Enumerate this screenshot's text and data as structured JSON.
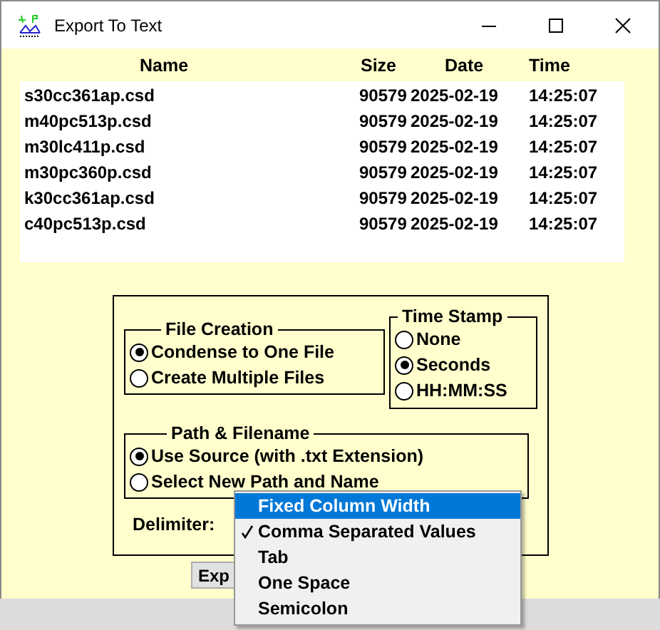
{
  "window": {
    "title": "Export To Text"
  },
  "table": {
    "columns": [
      "Name",
      "Size",
      "Date",
      "Time"
    ],
    "rows": [
      [
        "s30cc361ap.csd",
        "90579",
        "2025-02-19",
        "14:25:07"
      ],
      [
        "m40pc513p.csd",
        "90579",
        "2025-02-19",
        "14:25:07"
      ],
      [
        "m30lc411p.csd",
        "90579",
        "2025-02-19",
        "14:25:07"
      ],
      [
        "m30pc360p.csd",
        "90579",
        "2025-02-19",
        "14:25:07"
      ],
      [
        "k30cc361ap.csd",
        "90579",
        "2025-02-19",
        "14:25:07"
      ],
      [
        "c40pc513p.csd",
        "90579",
        "2025-02-19",
        "14:25:07"
      ]
    ]
  },
  "file_creation": {
    "title": "File Creation",
    "options": [
      {
        "label": "Condense to One File",
        "selected": true
      },
      {
        "label": "Create Multiple Files",
        "selected": false
      }
    ]
  },
  "time_stamp": {
    "title": "Time Stamp",
    "options": [
      {
        "label": "None",
        "selected": false
      },
      {
        "label": "Seconds",
        "selected": true
      },
      {
        "label": "HH:MM:SS",
        "selected": false
      }
    ]
  },
  "path_filename": {
    "title": "Path & Filename",
    "options": [
      {
        "label": "Use Source (with .txt Extension)",
        "selected": true
      },
      {
        "label": "Select New Path and Name",
        "selected": false
      }
    ]
  },
  "delimiter": {
    "label": "Delimiter:"
  },
  "export_button": {
    "label": "Exp"
  },
  "delimiter_menu": {
    "items": [
      {
        "label": "Fixed Column Width",
        "highlighted": true,
        "checked": false
      },
      {
        "label": "Comma Separated Values",
        "highlighted": false,
        "checked": true
      },
      {
        "label": "Tab",
        "highlighted": false,
        "checked": false
      },
      {
        "label": "One Space",
        "highlighted": false,
        "checked": false
      },
      {
        "label": "Semicolon",
        "highlighted": false,
        "checked": false
      }
    ]
  }
}
